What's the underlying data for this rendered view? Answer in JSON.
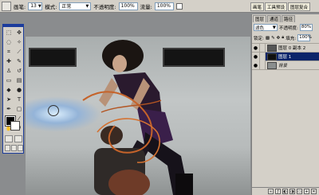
{
  "options_bar": {
    "brush_label": "画笔:",
    "brush_size": "13",
    "mode_label": "模式:",
    "mode_value": "正常",
    "opacity_label": "不透明度:",
    "opacity_value": "100%",
    "flow_label": "流量:",
    "flow_value": "100%"
  },
  "palette_well": [
    "画笔",
    "工具预设",
    "图层复合"
  ],
  "layers_panel": {
    "tabs": [
      "图层",
      "通道",
      "路径"
    ],
    "blend_mode": "滤色",
    "opacity_label": "不透明度:",
    "opacity_value": "80%",
    "lock_label": "锁定:",
    "fill_label": "填充:",
    "fill_value": "100%",
    "layers": [
      {
        "name": "图层 0 副本 2",
        "selected": false
      },
      {
        "name": "图层 1",
        "selected": true
      },
      {
        "name": "背景",
        "selected": false
      }
    ]
  },
  "icons": [
    "brush-tool-icon",
    "airbrush-icon",
    "eye-icon",
    "lock-icon"
  ],
  "colors": {
    "selection": "#0a246a",
    "chrome": "#d4d0c8",
    "toolbox_title": "#1c3c9c"
  }
}
